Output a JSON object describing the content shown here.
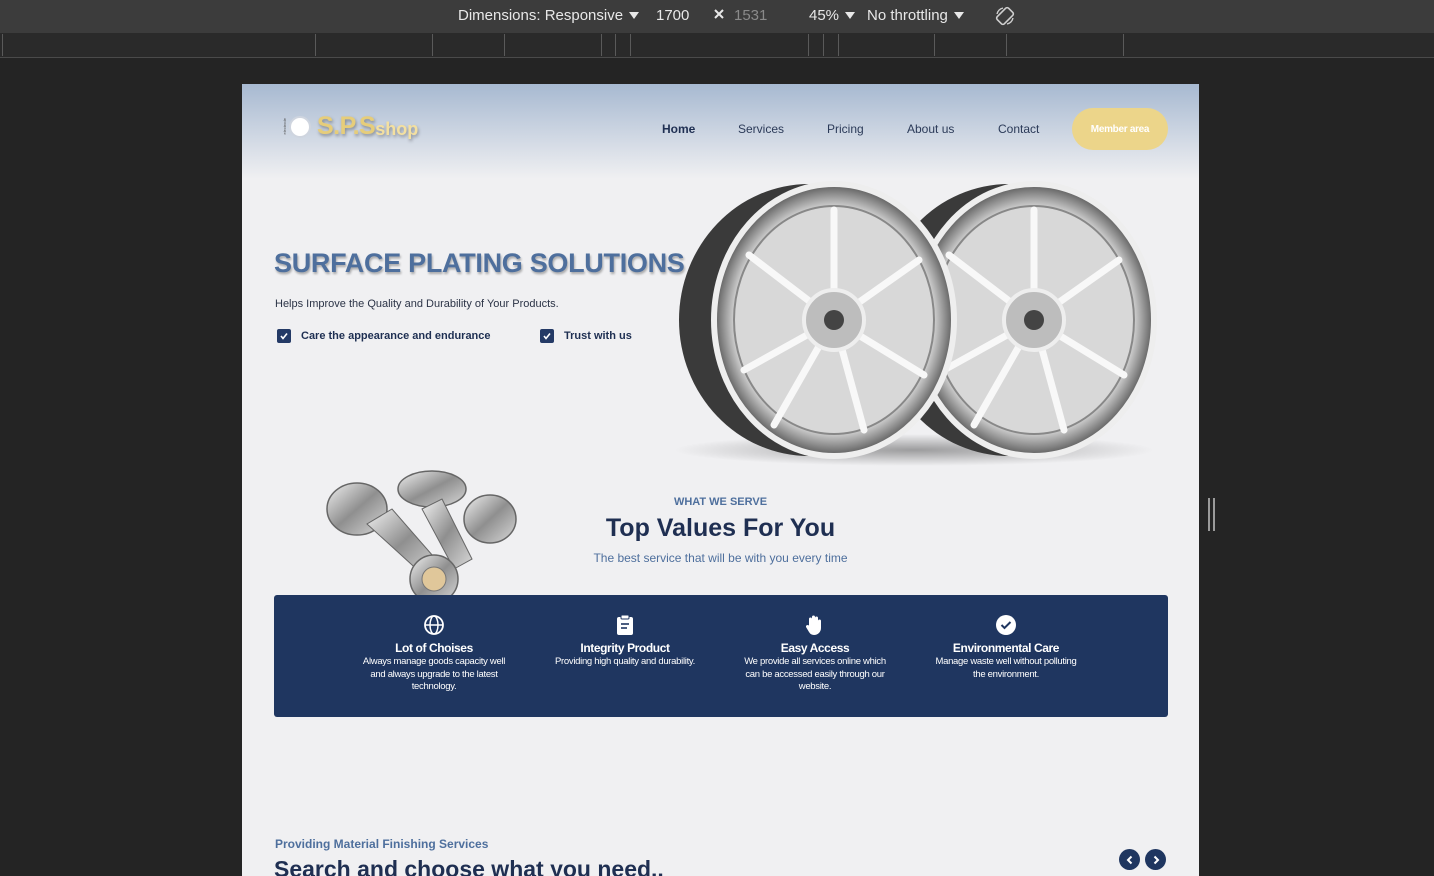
{
  "devtools": {
    "dimensions_label": "Dimensions: Responsive",
    "width_value": "1700",
    "height_value": "1531",
    "zoom": "45%",
    "throttling": "No throttling",
    "icons": [
      "caret-down-icon",
      "close-icon",
      "rotate-icon"
    ]
  },
  "site": {
    "logo_tiny": "electrode",
    "logo_main": "S.P.S",
    "logo_sub": "shop",
    "nav": [
      "Home",
      "Services",
      "Pricing",
      "About us",
      "Contact"
    ],
    "member_button": "Member area"
  },
  "hero": {
    "title": "SURFACE PLATING SOLUTIONS",
    "subtitle": "Helps Improve the Quality and Durability of Your Products.",
    "checks": [
      "Care the appearance and endurance",
      "Trust with us"
    ]
  },
  "what_we_serve": {
    "eyebrow": "WHAT WE SERVE",
    "title": "Top Values For You",
    "subtitle": "The best service that will be with you every time"
  },
  "features": [
    {
      "icon": "globe-icon",
      "title": "Lot of Choises",
      "desc": "Always manage goods capacity well and always upgrade to the latest technology."
    },
    {
      "icon": "clipboard-icon",
      "title": "Integrity Product",
      "desc": "Providing high quality and durability."
    },
    {
      "icon": "hand-icon",
      "title": "Easy Access",
      "desc": "We provide all services online which can be accessed easily through our website."
    },
    {
      "icon": "check-circle-icon",
      "title": "Environmental Care",
      "desc": "Manage waste well without polluting the environment."
    }
  ],
  "materials": {
    "eyebrow": "Providing Material Finishing Services",
    "title": "Search and choose what you need.."
  },
  "colors": {
    "brand_navy": "#1f3660",
    "accent_gold": "#ecd58a",
    "heading_blue": "#4e6f9d",
    "page_bg": "#f0f0f2"
  }
}
